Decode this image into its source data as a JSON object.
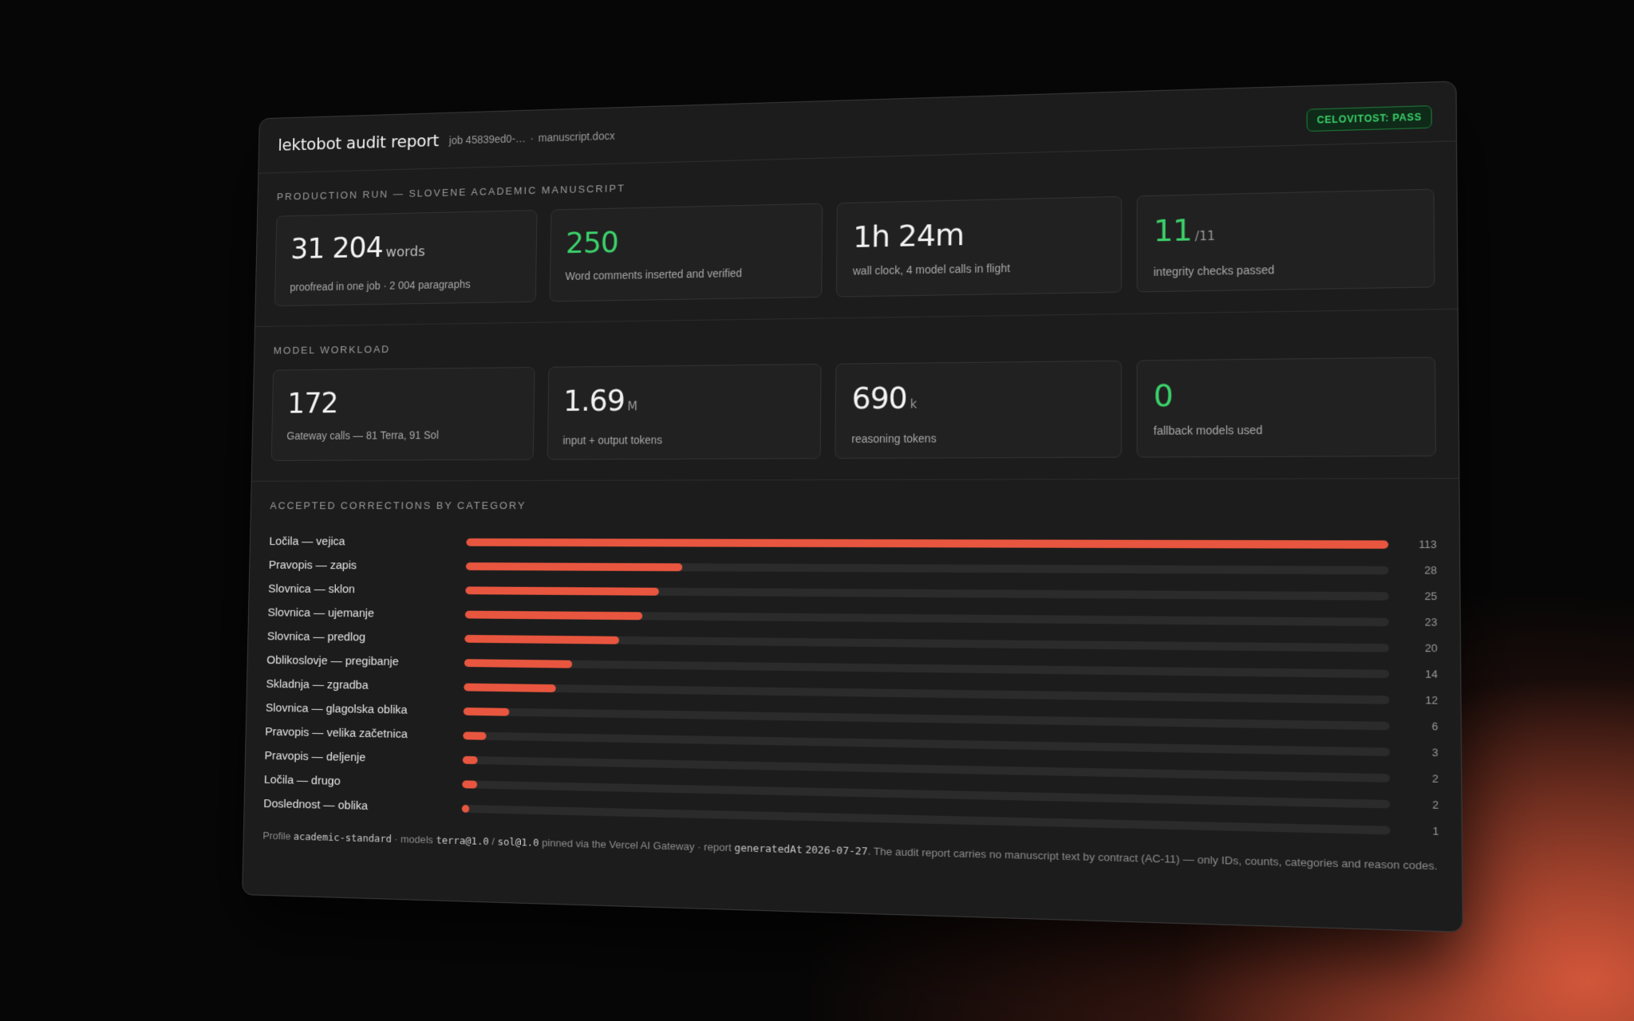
{
  "header": {
    "app_title": "lektobot audit report",
    "job": "job 45839ed0-…",
    "separator": "·",
    "file": "manuscript.docx",
    "status_badge": "CELOVITOST: PASS"
  },
  "production": {
    "label": "PRODUCTION RUN — SLOVENE ACADEMIC MANUSCRIPT",
    "cards": [
      {
        "value": "31 204",
        "unit": "words",
        "sub": "proofread in one job · 2 004 paragraphs",
        "accent": "white"
      },
      {
        "value": "250",
        "unit": "",
        "sub": "Word comments inserted and verified",
        "accent": "green"
      },
      {
        "value": "1h 24m",
        "unit": "",
        "sub": "wall clock, 4 model calls in flight",
        "accent": "white"
      },
      {
        "value": "11",
        "unit": "/11",
        "sub": "integrity checks passed",
        "accent": "green"
      }
    ]
  },
  "workload": {
    "label": "MODEL WORKLOAD",
    "cards": [
      {
        "value": "172",
        "unit": "",
        "sub": "Gateway calls — 81 Terra, 91 Sol",
        "accent": "white"
      },
      {
        "value": "1.69",
        "unit": "M",
        "sub": "input + output tokens",
        "accent": "white"
      },
      {
        "value": "690",
        "unit": "k",
        "sub": "reasoning tokens",
        "accent": "white"
      },
      {
        "value": "0",
        "unit": "",
        "sub": "fallback models used",
        "accent": "green"
      }
    ]
  },
  "corrections": {
    "label": "ACCEPTED CORRECTIONS BY CATEGORY",
    "max": 113,
    "bar_color": "#e8563f",
    "rows": [
      {
        "category": "Ločila — vejica",
        "count": 113
      },
      {
        "category": "Pravopis — zapis",
        "count": 28
      },
      {
        "category": "Slovnica — sklon",
        "count": 25
      },
      {
        "category": "Slovnica — ujemanje",
        "count": 23
      },
      {
        "category": "Slovnica — predlog",
        "count": 20
      },
      {
        "category": "Oblikoslovje — pregibanje",
        "count": 14
      },
      {
        "category": "Skladnja — zgradba",
        "count": 12
      },
      {
        "category": "Slovnica — glagolska oblika",
        "count": 6
      },
      {
        "category": "Pravopis — velika začetnica",
        "count": 3
      },
      {
        "category": "Pravopis — deljenje",
        "count": 2
      },
      {
        "category": "Ločila — drugo",
        "count": 2
      },
      {
        "category": "Doslednost — oblika",
        "count": 1
      }
    ]
  },
  "footer": {
    "profile_prefix": "Profile",
    "profile": "academic-standard",
    "models_prefix": "· models",
    "model_a": "terra@1.0",
    "model_sep": "/",
    "model_b": "sol@1.0",
    "pinned_text": "pinned via the Vercel AI Gateway · report",
    "generated_key": "generatedAt",
    "generated_date": "2026-07-27",
    "contract_text": ". The audit report carries no manuscript text by contract (AC-11) — only IDs, counts, categories and reason codes."
  },
  "colors": {
    "accent_green": "#3bd16a",
    "bar_orange": "#e8563f",
    "panel_bg": "#1c1c1c"
  }
}
